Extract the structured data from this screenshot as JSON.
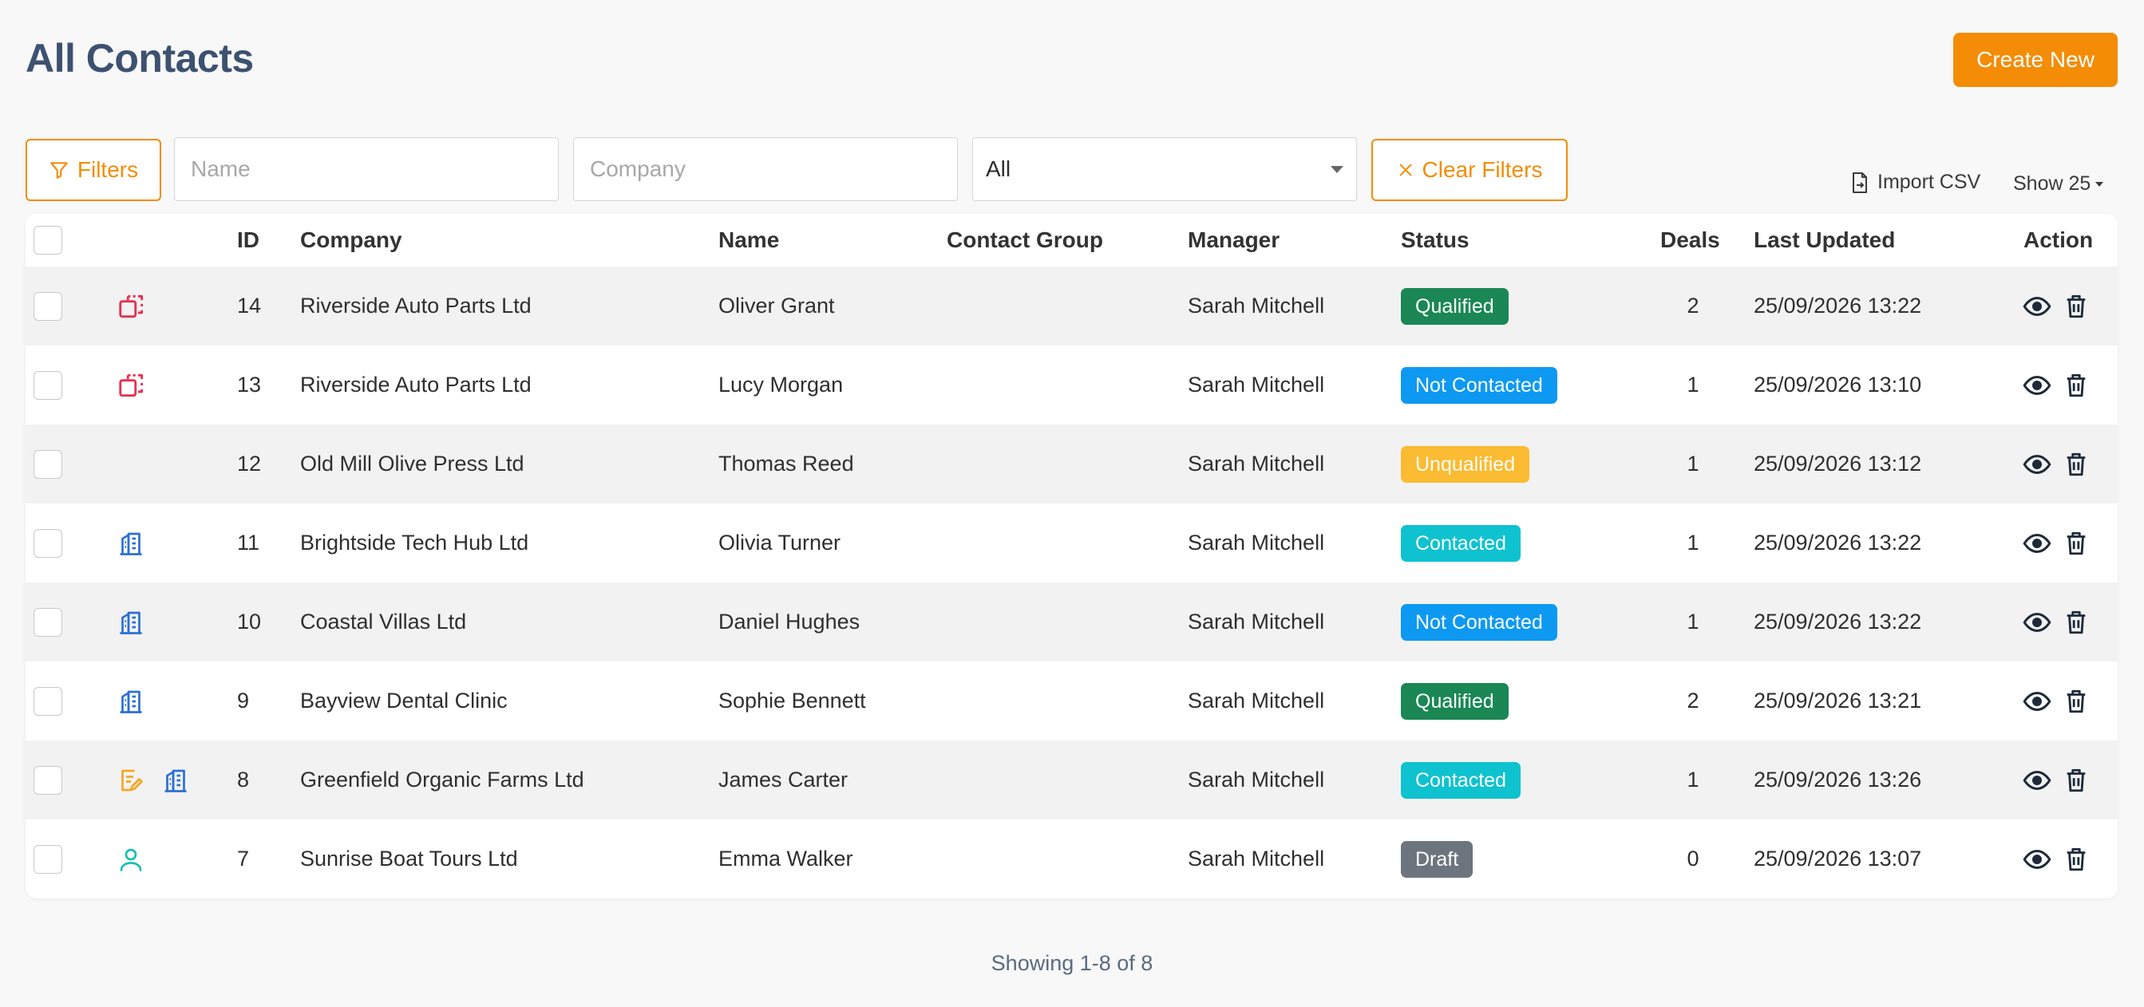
{
  "header": {
    "title": "All Contacts",
    "create_label": "Create New"
  },
  "filters": {
    "filters_label": "Filters",
    "name_placeholder": "Name",
    "company_placeholder": "Company",
    "status_selected": "All",
    "clear_label": "Clear Filters"
  },
  "toolbar": {
    "import_label": "Import CSV",
    "show_label": "Show 25"
  },
  "table": {
    "columns": {
      "id": "ID",
      "company": "Company",
      "name": "Name",
      "group": "Contact Group",
      "manager": "Manager",
      "status": "Status",
      "deals": "Deals",
      "updated": "Last Updated",
      "action": "Action"
    },
    "rows": [
      {
        "icons": [
          "duplicate-icon"
        ],
        "id": "14",
        "company": "Riverside Auto Parts Ltd",
        "name": "Oliver Grant",
        "group": "",
        "manager": "Sarah Mitchell",
        "status": "Qualified",
        "status_color": "#1a8754",
        "deals": "2",
        "updated": "25/09/2026 13:22"
      },
      {
        "icons": [
          "duplicate-icon"
        ],
        "id": "13",
        "company": "Riverside Auto Parts Ltd",
        "name": "Lucy Morgan",
        "group": "",
        "manager": "Sarah Mitchell",
        "status": "Not Contacted",
        "status_color": "#0d99f2",
        "deals": "1",
        "updated": "25/09/2026 13:10"
      },
      {
        "icons": [],
        "id": "12",
        "company": "Old Mill Olive Press Ltd",
        "name": "Thomas Reed",
        "group": "",
        "manager": "Sarah Mitchell",
        "status": "Unqualified",
        "status_color": "#fbbb32",
        "deals": "1",
        "updated": "25/09/2026 13:12"
      },
      {
        "icons": [
          "building-icon"
        ],
        "id": "11",
        "company": "Brightside Tech Hub Ltd",
        "name": "Olivia Turner",
        "group": "",
        "manager": "Sarah Mitchell",
        "status": "Contacted",
        "status_color": "#0fc2cf",
        "deals": "1",
        "updated": "25/09/2026 13:22"
      },
      {
        "icons": [
          "building-icon"
        ],
        "id": "10",
        "company": "Coastal Villas Ltd",
        "name": "Daniel Hughes",
        "group": "",
        "manager": "Sarah Mitchell",
        "status": "Not Contacted",
        "status_color": "#0d99f2",
        "deals": "1",
        "updated": "25/09/2026 13:22"
      },
      {
        "icons": [
          "building-icon"
        ],
        "id": "9",
        "company": "Bayview Dental Clinic",
        "name": "Sophie Bennett",
        "group": "",
        "manager": "Sarah Mitchell",
        "status": "Qualified",
        "status_color": "#1a8754",
        "deals": "2",
        "updated": "25/09/2026 13:21"
      },
      {
        "icons": [
          "edit-note-icon",
          "building-icon"
        ],
        "id": "8",
        "company": "Greenfield Organic Farms Ltd",
        "name": "James Carter",
        "group": "",
        "manager": "Sarah Mitchell",
        "status": "Contacted",
        "status_color": "#0fc2cf",
        "deals": "1",
        "updated": "25/09/2026 13:26"
      },
      {
        "icons": [
          "person-icon"
        ],
        "id": "7",
        "company": "Sunrise Boat Tours Ltd",
        "name": "Emma Walker",
        "group": "",
        "manager": "Sarah Mitchell",
        "status": "Draft",
        "status_color": "#6c757d",
        "deals": "0",
        "updated": "25/09/2026 13:07"
      }
    ]
  },
  "footer": {
    "showing": "Showing 1-8 of 8"
  },
  "colors": {
    "accent": "#f48c06",
    "title": "#3d5170"
  }
}
